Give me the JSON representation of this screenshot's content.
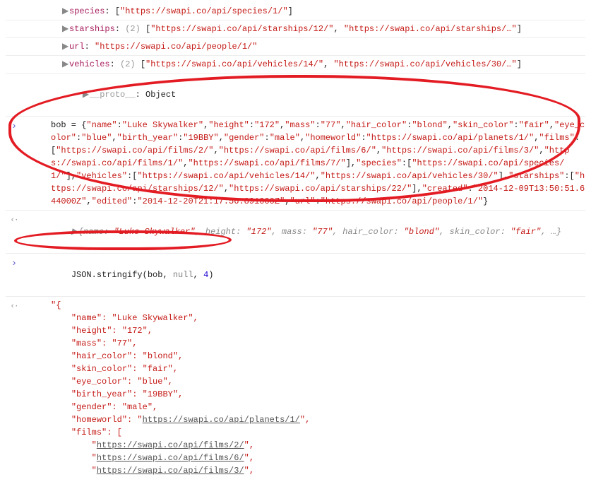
{
  "top_props": [
    {
      "key": "species",
      "count": null,
      "items": [
        "https://swapi.co/api/species/1/"
      ]
    },
    {
      "key": "starships",
      "count": 2,
      "items": [
        "https://swapi.co/api/starships/12/",
        "https://swapi.co/api/starships/…"
      ]
    },
    {
      "key": "url",
      "count": null,
      "text_value": "https://swapi.co/api/people/1/"
    },
    {
      "key": "vehicles",
      "count": 2,
      "items": [
        "https://swapi.co/api/vehicles/14/",
        "https://swapi.co/api/vehicles/30/…"
      ]
    }
  ],
  "proto_line": {
    "key": "__proto__",
    "value": "Object"
  },
  "bob_assign": {
    "prefix": "bob = ",
    "tokens": [
      {
        "t": "p",
        "v": "{"
      },
      {
        "t": "s",
        "v": "\"name\""
      },
      {
        "t": "p",
        "v": ":"
      },
      {
        "t": "s",
        "v": "\"Luke Skywalker\""
      },
      {
        "t": "p",
        "v": ","
      },
      {
        "t": "s",
        "v": "\"height\""
      },
      {
        "t": "p",
        "v": ":"
      },
      {
        "t": "s",
        "v": "\"172\""
      },
      {
        "t": "p",
        "v": ","
      },
      {
        "t": "s",
        "v": "\"mass\""
      },
      {
        "t": "p",
        "v": ":"
      },
      {
        "t": "s",
        "v": "\"77\""
      },
      {
        "t": "p",
        "v": ","
      },
      {
        "t": "s",
        "v": "\"hair_color\""
      },
      {
        "t": "p",
        "v": ":"
      },
      {
        "t": "s",
        "v": "\"blond\""
      },
      {
        "t": "p",
        "v": ","
      },
      {
        "t": "s",
        "v": "\"skin_color\""
      },
      {
        "t": "p",
        "v": ":"
      },
      {
        "t": "s",
        "v": "\"fair\""
      },
      {
        "t": "p",
        "v": ","
      },
      {
        "t": "s",
        "v": "\"eye_color\""
      },
      {
        "t": "p",
        "v": ":"
      },
      {
        "t": "s",
        "v": "\"blue\""
      },
      {
        "t": "p",
        "v": ","
      },
      {
        "t": "s",
        "v": "\"birth_year\""
      },
      {
        "t": "p",
        "v": ":"
      },
      {
        "t": "s",
        "v": "\"19BBY\""
      },
      {
        "t": "p",
        "v": ","
      },
      {
        "t": "s",
        "v": "\"gender\""
      },
      {
        "t": "p",
        "v": ":"
      },
      {
        "t": "s",
        "v": "\"male\""
      },
      {
        "t": "p",
        "v": ","
      },
      {
        "t": "s",
        "v": "\"homeworld\""
      },
      {
        "t": "p",
        "v": ":"
      },
      {
        "t": "s",
        "v": "\"https://swapi.co/api/planets/1/\""
      },
      {
        "t": "p",
        "v": ","
      },
      {
        "t": "s",
        "v": "\"films\""
      },
      {
        "t": "p",
        "v": ":["
      },
      {
        "t": "s",
        "v": "\"https://swapi.co/api/films/2/\""
      },
      {
        "t": "p",
        "v": ","
      },
      {
        "t": "s",
        "v": "\"https://swapi.co/api/films/6/\""
      },
      {
        "t": "p",
        "v": ","
      },
      {
        "t": "s",
        "v": "\"https://swapi.co/api/films/3/\""
      },
      {
        "t": "p",
        "v": ","
      },
      {
        "t": "s",
        "v": "\"https://swapi.co/api/films/1/\""
      },
      {
        "t": "p",
        "v": ","
      },
      {
        "t": "s",
        "v": "\"https://swapi.co/api/films/7/\""
      },
      {
        "t": "p",
        "v": "],"
      },
      {
        "t": "s",
        "v": "\"species\""
      },
      {
        "t": "p",
        "v": ":["
      },
      {
        "t": "s",
        "v": "\"https://swapi.co/api/species/1/\""
      },
      {
        "t": "p",
        "v": "],"
      },
      {
        "t": "s",
        "v": "\"vehicles\""
      },
      {
        "t": "p",
        "v": ":["
      },
      {
        "t": "s",
        "v": "\"https://swapi.co/api/vehicles/14/\""
      },
      {
        "t": "p",
        "v": ","
      },
      {
        "t": "s",
        "v": "\"https://swapi.co/api/vehicles/30/\""
      },
      {
        "t": "p",
        "v": "],"
      },
      {
        "t": "s",
        "v": "\"starships\""
      },
      {
        "t": "p",
        "v": ":["
      },
      {
        "t": "s",
        "v": "\"https://swapi.co/api/starships/12/\""
      },
      {
        "t": "p",
        "v": ","
      },
      {
        "t": "s",
        "v": "\"https://swapi.co/api/starships/22/\""
      },
      {
        "t": "p",
        "v": "],"
      },
      {
        "t": "s",
        "v": "\"created\""
      },
      {
        "t": "p",
        "v": ":"
      },
      {
        "t": "s",
        "v": "\"2014-12-09T13:50:51.644000Z\""
      },
      {
        "t": "p",
        "v": ","
      },
      {
        "t": "s",
        "v": "\"edited\""
      },
      {
        "t": "p",
        "v": ":"
      },
      {
        "t": "s",
        "v": "\"2014-12-20T21:17:56.891000Z\""
      },
      {
        "t": "p",
        "v": ","
      },
      {
        "t": "s",
        "v": "\"url\""
      },
      {
        "t": "p",
        "v": ":"
      },
      {
        "t": "s",
        "v": "\"https://swapi.co/api/people/1/\""
      },
      {
        "t": "p",
        "v": "}"
      }
    ]
  },
  "bob_result_preview": "{name: \"Luke Skywalker\", height: \"172\", mass: \"77\", hair_color: \"blond\", skin_color: \"fair\", …}",
  "stringify_call": {
    "fn": "JSON.stringify",
    "arg1": "bob",
    "arg2": "null",
    "arg3": "4"
  },
  "stringify_output": {
    "open": "\"{",
    "lines": [
      {
        "key": "\"name\"",
        "val": "\"Luke Skywalker\"",
        "comma": ","
      },
      {
        "key": "\"height\"",
        "val": "\"172\"",
        "comma": ","
      },
      {
        "key": "\"mass\"",
        "val": "\"77\"",
        "comma": ","
      },
      {
        "key": "\"hair_color\"",
        "val": "\"blond\"",
        "comma": ","
      },
      {
        "key": "\"skin_color\"",
        "val": "\"fair\"",
        "comma": ","
      },
      {
        "key": "\"eye_color\"",
        "val": "\"blue\"",
        "comma": ","
      },
      {
        "key": "\"birth_year\"",
        "val": "\"19BBY\"",
        "comma": ","
      },
      {
        "key": "\"gender\"",
        "val": "\"male\"",
        "comma": ","
      },
      {
        "key": "\"homeworld\"",
        "link": "https://swapi.co/api/planets/1/",
        "comma": ","
      },
      {
        "key": "\"films\"",
        "raw": ": ["
      }
    ],
    "films": [
      "https://swapi.co/api/films/2/",
      "https://swapi.co/api/films/6/",
      "https://swapi.co/api/films/3/"
    ]
  }
}
